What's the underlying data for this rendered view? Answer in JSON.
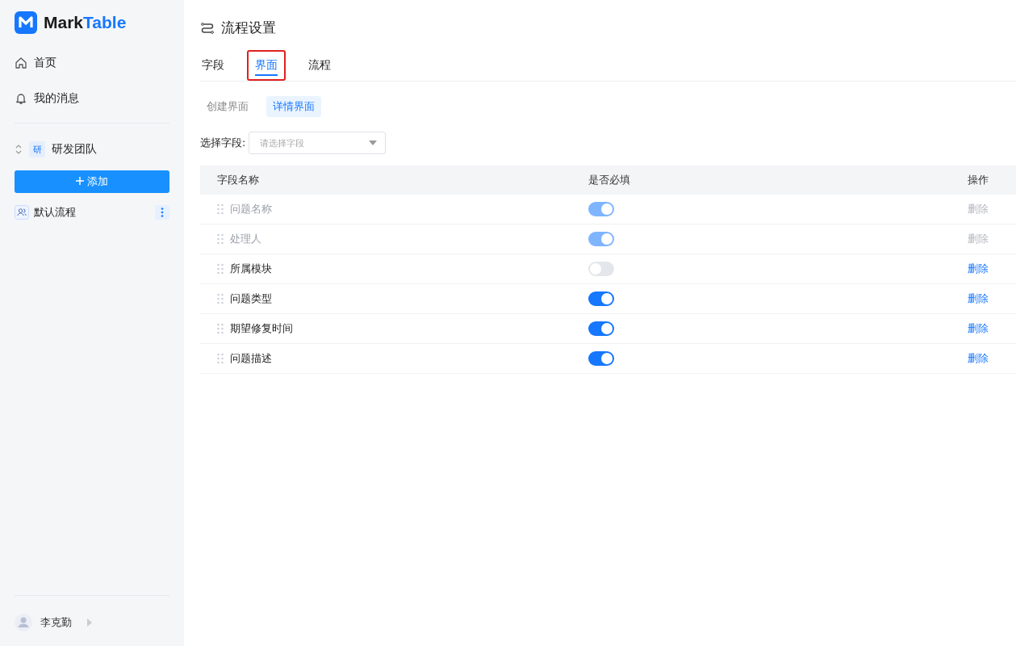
{
  "sidebar": {
    "logo": {
      "text": "Mark",
      "accent": "Table"
    },
    "nav": [
      {
        "kind": "home",
        "label": "首页"
      },
      {
        "kind": "bell",
        "label": "我的消息"
      }
    ],
    "team": {
      "badge": "研",
      "name": "研发团队"
    },
    "add_button": "添加",
    "flows": [
      {
        "label": "默认流程",
        "selected": true
      }
    ],
    "user": {
      "name": "李克勤"
    }
  },
  "page": {
    "title": "流程设置",
    "tabs": [
      {
        "label": "字段",
        "selected": false,
        "annotated": false
      },
      {
        "label": "界面",
        "selected": true,
        "annotated": true
      },
      {
        "label": "流程",
        "selected": false,
        "annotated": false
      }
    ],
    "subtabs": [
      {
        "label": "创建界面",
        "selected": false
      },
      {
        "label": "详情界面",
        "selected": true
      }
    ],
    "field_select": {
      "label": "选择字段:",
      "placeholder": "请选择字段"
    },
    "table": {
      "columns": [
        "字段名称",
        "是否必填",
        "操作"
      ],
      "rows": [
        {
          "name": "问题名称",
          "required": true,
          "locked": true,
          "action": "删除"
        },
        {
          "name": "处理人",
          "required": true,
          "locked": true,
          "action": "删除"
        },
        {
          "name": "所属模块",
          "required": false,
          "locked": false,
          "action": "删除"
        },
        {
          "name": "问题类型",
          "required": true,
          "locked": false,
          "action": "删除"
        },
        {
          "name": "期望修复时间",
          "required": true,
          "locked": false,
          "action": "删除"
        },
        {
          "name": "问题描述",
          "required": true,
          "locked": false,
          "action": "删除"
        }
      ]
    }
  }
}
